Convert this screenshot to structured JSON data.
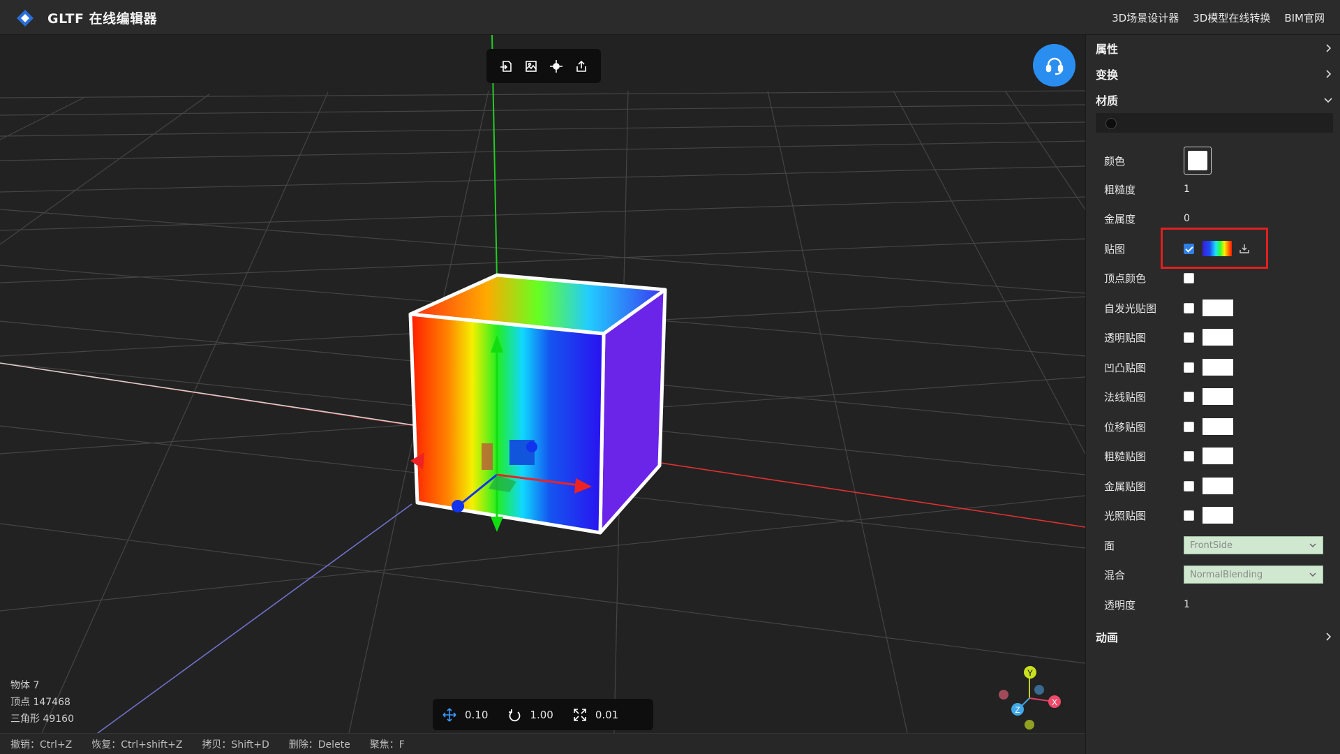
{
  "header": {
    "title": "GLTF 在线编辑器",
    "nav": [
      "3D场景设计器",
      "3D模型在线转换",
      "BIM官网"
    ]
  },
  "toolbar": {
    "icons": [
      "import-icon",
      "image-export-icon",
      "focus-icon",
      "share-icon"
    ]
  },
  "stats": {
    "objects": "物体 7",
    "vertices": "顶点 147468",
    "triangles": "三角形 49160"
  },
  "transform_steps": {
    "translate": "0.10",
    "rotate": "1.00",
    "scale": "0.01"
  },
  "shortcuts": [
    "撤销：Ctrl+Z",
    "恢复：Ctrl+shift+Z",
    "拷贝：Shift+D",
    "删除：Delete",
    "聚焦：F"
  ],
  "gizmo_axes": [
    "Y",
    "X",
    "Z"
  ],
  "panel": {
    "sections": {
      "properties": "属性",
      "transform": "变换",
      "material": "材质",
      "animation": "动画"
    },
    "material": {
      "color_label": "颜色",
      "color_value": "#ffffff",
      "roughness_label": "粗糙度",
      "roughness_value": "1",
      "metalness_label": "金属度",
      "metalness_value": "0",
      "map_label": "贴图",
      "map_enabled": true,
      "vertex_colors_label": "顶点颜色",
      "texture_maps": [
        "自发光贴图",
        "透明贴图",
        "凹凸贴图",
        "法线贴图",
        "位移贴图",
        "粗糙贴图",
        "金属贴图",
        "光照贴图"
      ],
      "side_label": "面",
      "side_value": "FrontSide",
      "blending_label": "混合",
      "blending_value": "NormalBlending",
      "opacity_label": "透明度",
      "opacity_value": "1"
    }
  },
  "colors": {
    "accent": "#2a8ef0",
    "highlight": "#e02020",
    "axis_x": "#e03030",
    "axis_y": "#22cc22",
    "axis_z": "#7070cc"
  }
}
